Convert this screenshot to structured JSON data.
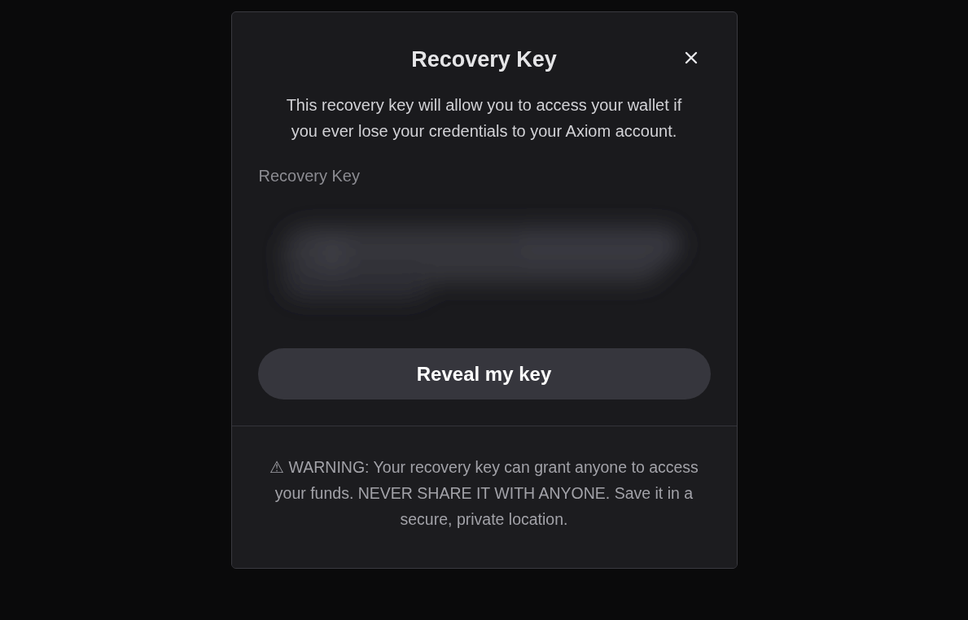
{
  "dialog": {
    "title": "Recovery Key",
    "description": "This recovery key will allow you to access your wallet if you ever lose your credentials to your Axiom account.",
    "key_field": {
      "label": "Recovery Key",
      "revealed": false
    },
    "button": "Reveal my key",
    "warning": "⚠ WARNING: Your recovery key can grant anyone to access your funds. NEVER SHARE IT WITH ANYONE. Save it in a secure, private location."
  }
}
